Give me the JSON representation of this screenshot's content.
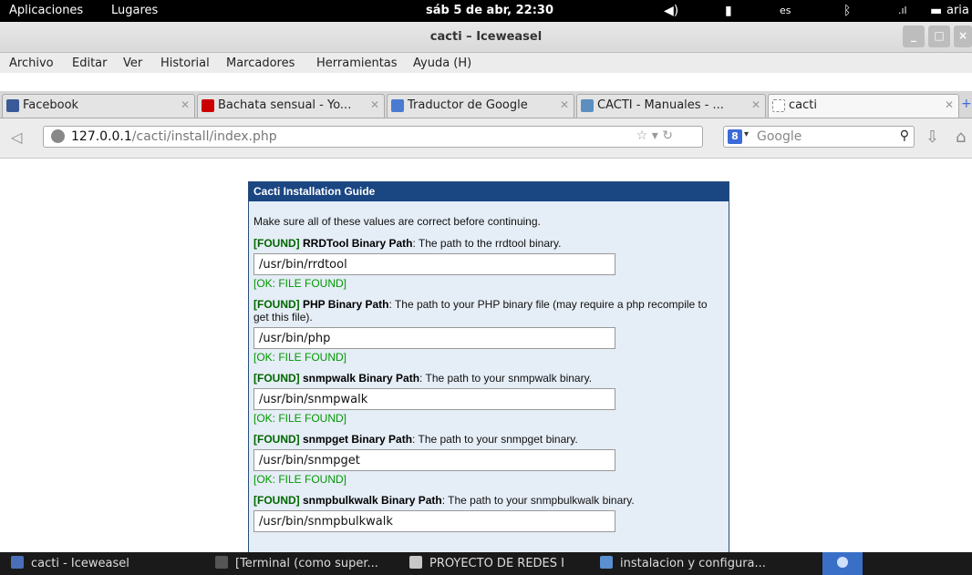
{
  "top_panel": {
    "applications": "Aplicaciones",
    "places": "Lugares",
    "clock": "sáb  5 de abr, 22:30",
    "keyboard_layout": "es",
    "user": "aria"
  },
  "window": {
    "title": "cacti – Iceweasel"
  },
  "menu": [
    "Archivo",
    "Editar",
    "Ver",
    "Historial",
    "Marcadores",
    "Herramientas",
    "Ayuda (H)"
  ],
  "tabs": [
    {
      "label": "Facebook",
      "icon_color": "#3b5998"
    },
    {
      "label": "Bachata sensual - Yo...",
      "icon_color": "#cc0000"
    },
    {
      "label": "Traductor de Google",
      "icon_color": "#4a7bd0"
    },
    {
      "label": "CACTI - Manuales - ...",
      "icon_color": "#5a8fc0"
    },
    {
      "label": "cacti",
      "icon_color": "#ffffff"
    }
  ],
  "navbar": {
    "url_host": "127.0.0.1",
    "url_path": "/cacti/install/index.php",
    "search_placeholder": "Google"
  },
  "guide": {
    "header": "Cacti Installation Guide",
    "intro": "Make sure all of these values are correct before continuing.",
    "found_tag": "[FOUND]",
    "items": [
      {
        "label": "RRDTool Binary Path",
        "desc": ": The path to the rrdtool binary.",
        "value": "/usr/bin/rrdtool",
        "status": "[OK: FILE FOUND]"
      },
      {
        "label": "PHP Binary Path",
        "desc": ": The path to your PHP binary file (may require a php recompile to get this file).",
        "value": "/usr/bin/php",
        "status": "[OK: FILE FOUND]"
      },
      {
        "label": "snmpwalk Binary Path",
        "desc": ": The path to your snmpwalk binary.",
        "value": "/usr/bin/snmpwalk",
        "status": "[OK: FILE FOUND]"
      },
      {
        "label": "snmpget Binary Path",
        "desc": ": The path to your snmpget binary.",
        "value": "/usr/bin/snmpget",
        "status": "[OK: FILE FOUND]"
      },
      {
        "label": "snmpbulkwalk Binary Path",
        "desc": ": The path to your snmpbulkwalk binary.",
        "value": "/usr/bin/snmpbulkwalk",
        "status": ""
      }
    ]
  },
  "taskbar": [
    {
      "label": "cacti - Iceweasel",
      "icon_color": "#4a6fb8"
    },
    {
      "label": "[Terminal (como super...",
      "icon_color": "#555555"
    },
    {
      "label": "PROYECTO DE REDES I",
      "icon_color": "#c8c8c8"
    },
    {
      "label": "instalacion y configura...",
      "icon_color": "#5a8fd0"
    }
  ]
}
